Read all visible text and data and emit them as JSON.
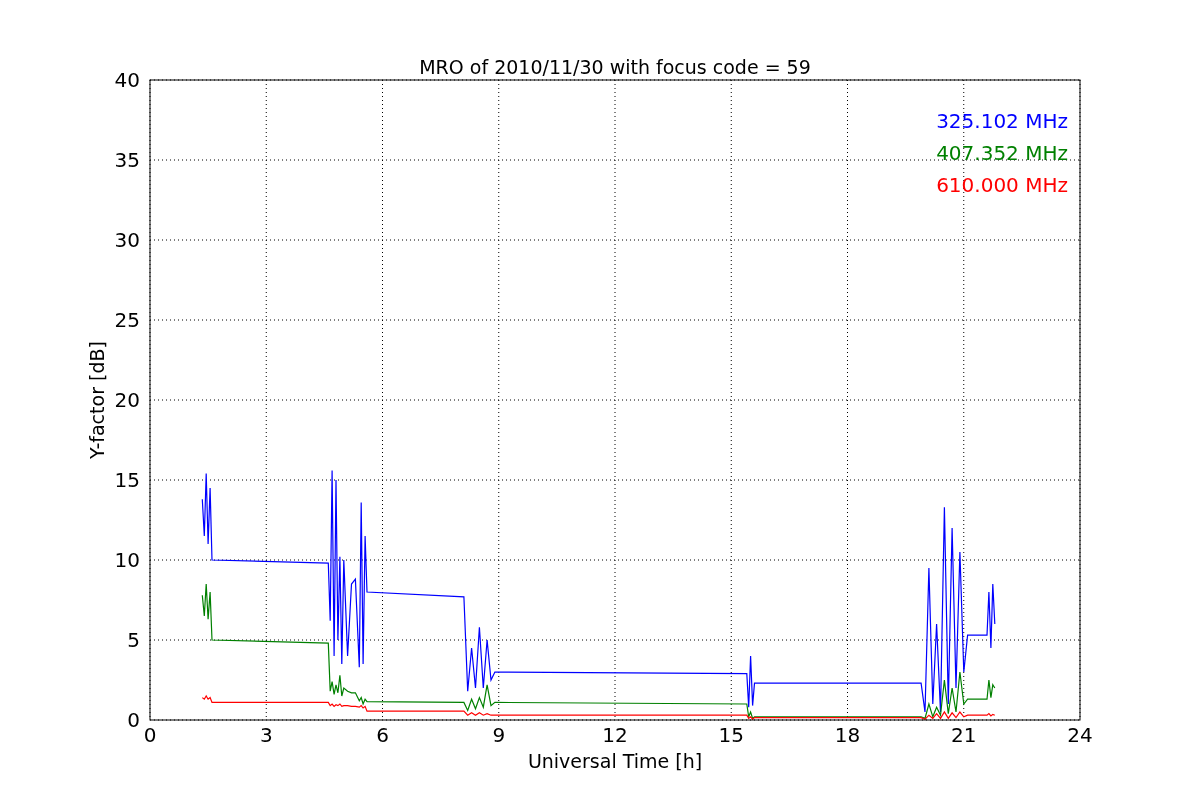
{
  "chart_data": {
    "type": "line",
    "title": "MRO of 2010/11/30 with focus code = 59",
    "xlabel": "Universal Time [h]",
    "ylabel": "Y-factor [dB]",
    "x": [
      1.35,
      1.4,
      1.45,
      1.5,
      1.55,
      1.6,
      4.6,
      4.65,
      4.7,
      4.75,
      4.8,
      4.85,
      4.9,
      4.95,
      5.0,
      5.1,
      5.2,
      5.3,
      5.4,
      5.45,
      5.5,
      5.55,
      5.6,
      8.1,
      8.2,
      8.3,
      8.4,
      8.5,
      8.6,
      8.7,
      8.8,
      8.9,
      15.4,
      15.45,
      15.5,
      15.55,
      15.6,
      19.9,
      20.0,
      20.1,
      20.2,
      20.3,
      20.4,
      20.5,
      20.6,
      20.7,
      20.8,
      20.9,
      21.0,
      21.1,
      21.6,
      21.65,
      21.7,
      21.75,
      21.8
    ],
    "series": [
      {
        "name": "325.102 MHz",
        "color": "#0000ff",
        "values": [
          13.8,
          11.5,
          15.4,
          11,
          14.5,
          10,
          9.8,
          6.2,
          15.6,
          4,
          15,
          5,
          10.2,
          3.5,
          10,
          4,
          8.5,
          8.8,
          3.3,
          13.6,
          3.5,
          11.5,
          8.0,
          7.7,
          1.8,
          4.5,
          2,
          5.8,
          2,
          5,
          2.5,
          3.0,
          2.9,
          0.8,
          4,
          0.9,
          2.3,
          2.3,
          0.5,
          9.5,
          1,
          6,
          0.5,
          13.3,
          1,
          12,
          2,
          10.5,
          3,
          5.3,
          5.3,
          8,
          4.5,
          8.5,
          6
        ]
      },
      {
        "name": "407.352 MHz",
        "color": "#008000",
        "values": [
          7.8,
          6.5,
          8.5,
          6.3,
          8,
          5.0,
          4.8,
          1.8,
          2.4,
          1.6,
          2.2,
          1.7,
          2.8,
          1.5,
          2.0,
          1.8,
          1.7,
          1.7,
          1.2,
          1.4,
          1.0,
          1.3,
          1.15,
          1.1,
          0.6,
          1.3,
          0.7,
          1.4,
          0.8,
          2.2,
          0.9,
          1.1,
          1.0,
          0.2,
          0.5,
          0.1,
          0.2,
          0.2,
          0.1,
          1.0,
          0.2,
          0.8,
          0.3,
          2.5,
          0.4,
          2.0,
          0.5,
          3.0,
          1.0,
          1.3,
          1.3,
          2.5,
          1.4,
          2.2,
          2.0
        ]
      },
      {
        "name": "610.000 MHz",
        "color": "#ff0000",
        "values": [
          1.4,
          1.3,
          1.5,
          1.3,
          1.4,
          1.1,
          1.1,
          0.9,
          1.0,
          0.85,
          0.95,
          0.9,
          1.0,
          0.85,
          0.9,
          0.9,
          0.85,
          0.85,
          0.8,
          0.9,
          0.75,
          0.85,
          0.55,
          0.55,
          0.3,
          0.45,
          0.3,
          0.45,
          0.3,
          0.4,
          0.3,
          0.3,
          0.3,
          0.1,
          0.2,
          0.05,
          0.15,
          0.15,
          0.05,
          0.3,
          0.1,
          0.4,
          0.1,
          0.5,
          0.1,
          0.45,
          0.15,
          0.5,
          0.2,
          0.3,
          0.3,
          0.4,
          0.25,
          0.35,
          0.3
        ]
      }
    ],
    "grid": true,
    "xlim": [
      0,
      24
    ],
    "ylim": [
      0,
      40
    ],
    "xticks": [
      0,
      3,
      6,
      9,
      12,
      15,
      18,
      21,
      24
    ],
    "yticks": [
      0,
      5,
      10,
      15,
      20,
      25,
      30,
      35,
      40
    ]
  }
}
